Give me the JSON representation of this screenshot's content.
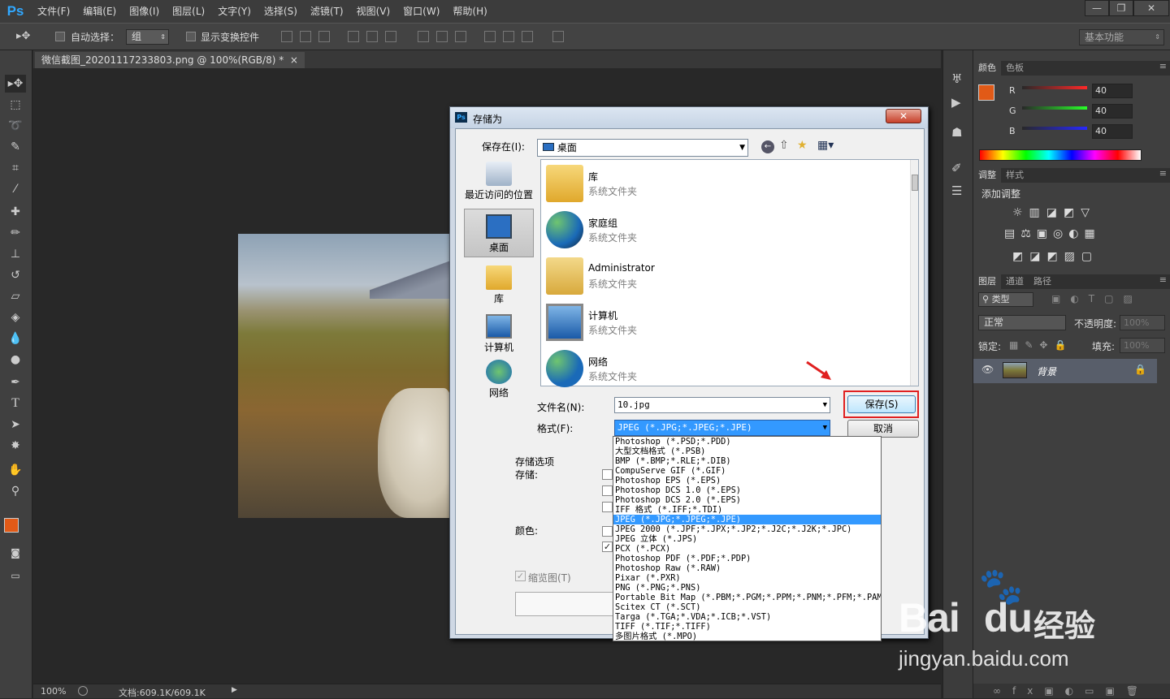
{
  "menubar": {
    "logo": "Ps",
    "items": [
      "文件(F)",
      "编辑(E)",
      "图像(I)",
      "图层(L)",
      "文字(Y)",
      "选择(S)",
      "滤镜(T)",
      "视图(V)",
      "窗口(W)",
      "帮助(H)"
    ],
    "window_buttons": [
      "—",
      "❐",
      "✕"
    ]
  },
  "options_bar": {
    "auto_select_label": "自动选择：",
    "auto_select_value": "组",
    "show_transform_label": "显示变换控件",
    "workspace_value": "基本功能"
  },
  "document": {
    "tab_title": "微信截图_20201117233803.png @ 100%(RGB/8) *",
    "tab_close": "×",
    "zoom": "100%",
    "doc_info": "文档:609.1K/609.1K"
  },
  "right_panel": {
    "color_tabs": [
      "颜色",
      "色板"
    ],
    "color_channels": [
      {
        "name": "R",
        "value": "40"
      },
      {
        "name": "G",
        "value": "40"
      },
      {
        "name": "B",
        "value": "40"
      }
    ],
    "foreground_color": "#e15a17",
    "adjust_tabs": [
      "调整",
      "样式"
    ],
    "adjust_title": "添加调整",
    "layer_tabs": [
      "图层",
      "通道",
      "路径"
    ],
    "layer_filter": "类型",
    "blend_mode": "正常",
    "opacity_label": "不透明度:",
    "opacity_value": "100%",
    "lock_label": "锁定:",
    "fill_label": "填充:",
    "fill_value": "100%",
    "layer_name": "背景"
  },
  "dialog": {
    "title": "存储为",
    "save_in_label": "保存在(I):",
    "save_in_value": "桌面",
    "places": [
      "最近访问的位置",
      "桌面",
      "库",
      "计算机",
      "网络"
    ],
    "files": [
      {
        "name": "库",
        "type": "系统文件夹"
      },
      {
        "name": "家庭组",
        "type": "系统文件夹"
      },
      {
        "name": "Administrator",
        "type": "系统文件夹"
      },
      {
        "name": "计算机",
        "type": "系统文件夹"
      },
      {
        "name": "网络",
        "type": "系统文件夹"
      }
    ],
    "filename_label": "文件名(N):",
    "filename_value": "10.jpg",
    "format_label": "格式(F):",
    "format_value": "JPEG (*.JPG;*.JPEG;*.JPE)",
    "save_button": "保存(S)",
    "cancel_button": "取消",
    "save_options_label": "存储选项",
    "storage_label": "存储:",
    "color_label": "颜色:",
    "thumbnail_label": "缩览图(T)",
    "format_options": [
      "Photoshop (*.PSD;*.PDD)",
      "大型文档格式 (*.PSB)",
      "BMP (*.BMP;*.RLE;*.DIB)",
      "CompuServe GIF (*.GIF)",
      "Photoshop EPS (*.EPS)",
      "Photoshop DCS 1.0 (*.EPS)",
      "Photoshop DCS 2.0 (*.EPS)",
      "IFF 格式 (*.IFF;*.TDI)",
      "JPEG (*.JPG;*.JPEG;*.JPE)",
      "JPEG 2000 (*.JPF;*.JPX;*.JP2;*.J2C;*.J2K;*.JPC)",
      "JPEG 立体 (*.JPS)",
      "PCX (*.PCX)",
      "Photoshop PDF (*.PDF;*.PDP)",
      "Photoshop Raw (*.RAW)",
      "Pixar (*.PXR)",
      "PNG (*.PNG;*.PNS)",
      "Portable Bit Map (*.PBM;*.PGM;*.PPM;*.PNM;*.PFM;*.PAM)",
      "Scitex CT (*.SCT)",
      "Targa (*.TGA;*.VDA;*.ICB;*.VST)",
      "TIFF (*.TIF;*.TIFF)",
      "多图片格式 (*.MPO)"
    ],
    "selected_format_index": 8
  },
  "watermark": {
    "brand": "Bai",
    "brand2": "du",
    "cn": "经验",
    "url": "jingyan.baidu.com"
  }
}
